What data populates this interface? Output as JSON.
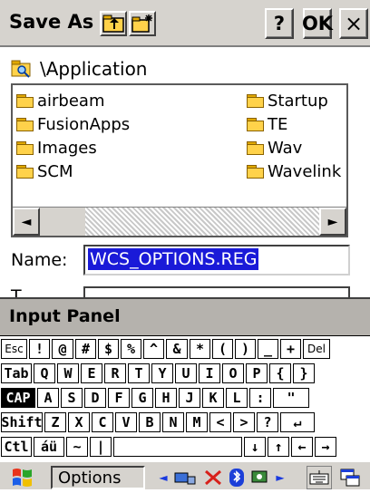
{
  "dialog": {
    "title": "Save As",
    "help_label": "?",
    "ok_label": "OK",
    "close_label": "×",
    "path": "\\Application"
  },
  "files": {
    "left": [
      "airbeam",
      "FusionApps",
      "Images",
      "SCM"
    ],
    "right": [
      "Startup",
      "TE",
      "Wav",
      "Wavelink"
    ]
  },
  "scroll": {
    "left_arrow": "◄",
    "right_arrow": "►"
  },
  "name_field": {
    "label": "Name:",
    "value": "WCS_OPTIONS.REG"
  },
  "type_field": {
    "label": "T"
  },
  "input_panel": {
    "title": "Input Panel"
  },
  "keyboard": {
    "row1": [
      "Esc",
      "!",
      "@",
      "#",
      "$",
      "%",
      "^",
      "&",
      "*",
      "(",
      ")",
      "_",
      "+",
      "Del"
    ],
    "row2": [
      "Tab",
      "Q",
      "W",
      "E",
      "R",
      "T",
      "Y",
      "U",
      "I",
      "O",
      "P",
      "{",
      "}"
    ],
    "row3": [
      "CAP",
      "A",
      "S",
      "D",
      "F",
      "G",
      "H",
      "J",
      "K",
      "L",
      ":",
      "\""
    ],
    "row4": [
      "Shift",
      "Z",
      "X",
      "C",
      "V",
      "B",
      "N",
      "M",
      "<",
      ">",
      "?",
      "↵"
    ],
    "row5": [
      "Ctl",
      "áü",
      "~",
      "|",
      "",
      "↓",
      "↑",
      "←",
      "→"
    ]
  },
  "taskbar": {
    "options_label": "Options",
    "start_icon": "windows-flag-icon",
    "tray_icons": [
      "network-icon",
      "bluetooth-icon",
      "sync-icon"
    ]
  }
}
